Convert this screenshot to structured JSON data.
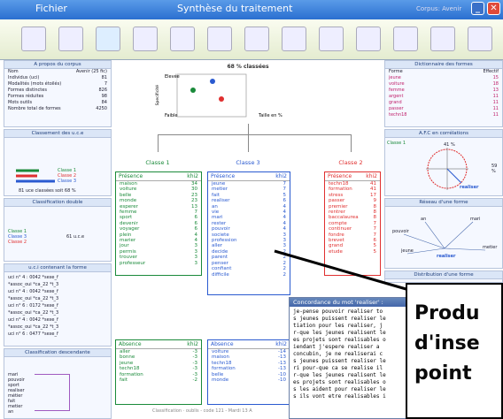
{
  "titlebar": {
    "menu": "Fichier",
    "title": "Synthèse du traitement",
    "corpus": "Corpus: Avenir"
  },
  "corpus_panel": {
    "title": "A propos du corpus",
    "rows": [
      [
        "Nom",
        "Avenir (25 fic)"
      ],
      [
        "Individus (uci)",
        "81"
      ],
      [
        "Modalités (mots étoilés)",
        "7"
      ],
      [
        "Formes distinctes",
        "826"
      ],
      [
        "Formes réduites",
        "98"
      ],
      [
        "Mots outils",
        "84"
      ],
      [
        "Nombre total de formes",
        "4250"
      ]
    ]
  },
  "classement": {
    "title": "Classement des u.c.e",
    "legend": [
      "Classe 1",
      "Classe 2",
      "Classe 3"
    ],
    "footer": "81 uce classées soit 68 %"
  },
  "classif_double": {
    "title": "Classification double",
    "items": [
      "Classe 1",
      "Classe 3",
      "Classe 2"
    ],
    "suffix": "61 u.c.e"
  },
  "uci_panel": {
    "title": "u.c.i contenant la forme",
    "lines": [
      "uci n° 4 : 0042 *sexe_f",
      "*assoc_oui *ca_22 *t_3",
      "uci n° 4 : 0042 *sexe_f",
      "*assoc_oui *ca_22 *t_3",
      "uci n° 6 : 0172 *sexe_f",
      "*assoc_oui *ca_22 *t_3",
      "uci n° 4 : 0042 *sexe_f",
      "*assoc_oui *ca_22 *t_3",
      "uci n° 6 : 0477 *sexe_f"
    ]
  },
  "classif_desc": {
    "title": "Classification descendante",
    "words": [
      "mari",
      "pouvoir",
      "sport",
      "realiser",
      "métier",
      "fait",
      "metier",
      "an"
    ]
  },
  "center": {
    "title": "68 % classées",
    "axis_y": "Specificité",
    "axis_x": "Taille en %",
    "high": "Elevée",
    "low": "Faible",
    "footer": "Classification · oublis - code 121 - Mardi 13 A"
  },
  "classes": [
    {
      "label": "Classe 1",
      "head": [
        "Présence",
        "khi2"
      ],
      "rows": [
        [
          "maison",
          "34"
        ],
        [
          "voiture",
          "30"
        ],
        [
          "belle",
          "23"
        ],
        [
          "monde",
          "23"
        ],
        [
          "esperer",
          "13"
        ],
        [
          "femme",
          "7"
        ],
        [
          "sport",
          "6"
        ],
        [
          "devenir",
          "6"
        ],
        [
          "voyager",
          "6"
        ],
        [
          "plein",
          "4"
        ],
        [
          "marier",
          "4"
        ],
        [
          "jour",
          "3"
        ],
        [
          "permis",
          "3"
        ],
        [
          "trouver",
          "3"
        ],
        [
          "professeur",
          "3"
        ]
      ],
      "absent_head": [
        "Absence",
        "khi2"
      ],
      "absent": [
        [
          "aller",
          "-3"
        ],
        [
          "bonne",
          "-3"
        ],
        [
          "jeune",
          "-3"
        ],
        [
          "techn18",
          "-3"
        ],
        [
          "formation",
          "-3"
        ],
        [
          "fait",
          "-2"
        ]
      ]
    },
    {
      "label": "Classe 3",
      "head": [
        "Présence",
        "khi2"
      ],
      "rows": [
        [
          "jeune",
          "7"
        ],
        [
          "metier",
          "7"
        ],
        [
          "fait",
          "5"
        ],
        [
          "realiser",
          "6"
        ],
        [
          "an",
          "4"
        ],
        [
          "vie",
          "4"
        ],
        [
          "mari",
          "4"
        ],
        [
          "rester",
          "4"
        ],
        [
          "pouvoir",
          "4"
        ],
        [
          "societe",
          "3"
        ],
        [
          "profession",
          "3"
        ],
        [
          "aller",
          "3"
        ],
        [
          "decide",
          "2"
        ],
        [
          "parent",
          "2"
        ],
        [
          "penser",
          "2"
        ],
        [
          "confiant",
          "2"
        ],
        [
          "difficile",
          "2"
        ]
      ],
      "absent_head": [
        "Absence",
        "khi2"
      ],
      "absent": [
        [
          "voiture",
          "-14"
        ],
        [
          "maison",
          "-13"
        ],
        [
          "techn18",
          "-13"
        ],
        [
          "formation",
          "-13"
        ],
        [
          "belle",
          "-10"
        ],
        [
          "monde",
          "-10"
        ]
      ]
    },
    {
      "label": "Classe 2",
      "head": [
        "Présence",
        "khi2"
      ],
      "rows": [
        [
          "techn18",
          "41"
        ],
        [
          "formation",
          "41"
        ],
        [
          "stress",
          "17"
        ],
        [
          "passer",
          "9"
        ],
        [
          "premier",
          "8"
        ],
        [
          "rentrer",
          "8"
        ],
        [
          "baccalaurea",
          "8"
        ],
        [
          "compte",
          "7"
        ],
        [
          "continuer",
          "7"
        ],
        [
          "fondre",
          "7"
        ],
        [
          "brevet",
          "6"
        ],
        [
          "grand",
          "5"
        ],
        [
          "etude",
          "5"
        ]
      ]
    }
  ],
  "dict_panel": {
    "title": "Dictionnaire des formes",
    "head": [
      "Forme",
      "Effectif"
    ],
    "rows": [
      [
        "jeune",
        "15"
      ],
      [
        "voiture",
        "18"
      ],
      [
        "femme",
        "13"
      ],
      [
        "argent",
        "11"
      ],
      [
        "grand",
        "11"
      ],
      [
        "passer",
        "11"
      ],
      [
        "techn18",
        "11"
      ]
    ]
  },
  "afc_panel": {
    "title": "A.F.C en corrélations",
    "axis_label": "Classe 1",
    "angle": "41 %",
    "word": "realiser",
    "side": "59 %"
  },
  "reseau_panel": {
    "title": "Réseau d'une forme",
    "words": [
      "an",
      "mari",
      "pouvoir",
      "jeune",
      "metier",
      "realiser"
    ]
  },
  "distrib_panel": {
    "title": "Distribution d'une forme"
  },
  "concordance": {
    "title": "Concordance du mot 'realiser' :",
    "lines": [
      "je-pense pouvoir realiser to",
      "s jeunes puissent realiser le",
      "tiation pour les realiser, j",
      "r-que les jeunes realisent le",
      "es projets sont realisables o",
      "iendant j'espere realiser a",
      "concubin, je ne realiserai c",
      "s jeunes puissent realiser le",
      "ri pour-que ca se realise il",
      "r-que les jeunes realisent le",
      "es projets sont realisables o",
      "s les aident pour realiser le",
      "s ils vont etre realisables i"
    ]
  },
  "overlay": {
    "lines": [
      "Produ",
      "d'inse",
      "point"
    ]
  },
  "colors": {
    "class1": "#1a8a3a",
    "class2": "#e03030",
    "class3": "#2a5ad0",
    "title_bg": "#2a6fd0"
  }
}
